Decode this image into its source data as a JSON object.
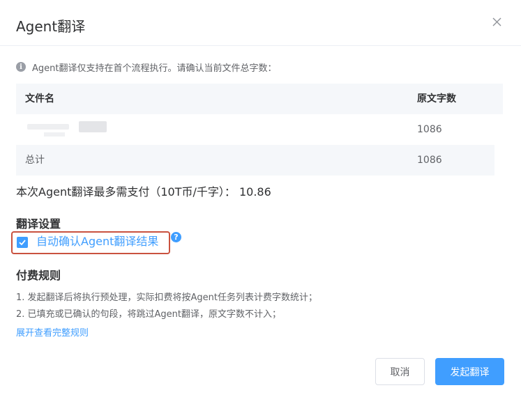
{
  "dialog": {
    "title": "Agent翻译",
    "close_icon": "close-icon"
  },
  "notice": {
    "icon": "info-icon",
    "text": "Agent翻译仅支持在首个流程执行。请确认当前文件总字数："
  },
  "table": {
    "columns": [
      "文件名",
      "原文字数"
    ],
    "rows": [
      {
        "file_name": "",
        "char_count": "1086"
      }
    ],
    "total": {
      "label": "总计",
      "char_count": "1086"
    }
  },
  "payment_text": "本次Agent翻译最多需支付（10T币/千字）： 10.86",
  "translation_settings": {
    "title": "翻译设置",
    "auto_confirm": {
      "label": "自动确认Agent翻译结果",
      "checked": true
    },
    "help_icon_text": "?"
  },
  "billing_rules": {
    "title": "付费规则",
    "rules": [
      "1. 发起翻译后将执行预处理，实际扣费将按Agent任务列表计费字数统计；",
      "2. 已填充或已确认的句段，将跳过Agent翻译，原文字数不计入；"
    ],
    "expand_link": "展开查看完整规则"
  },
  "footer": {
    "cancel_label": "取消",
    "confirm_label": "发起翻译"
  },
  "colors": {
    "primary": "#409eff",
    "highlight_border": "#c9523f",
    "table_header_bg": "#f5f7fa"
  }
}
